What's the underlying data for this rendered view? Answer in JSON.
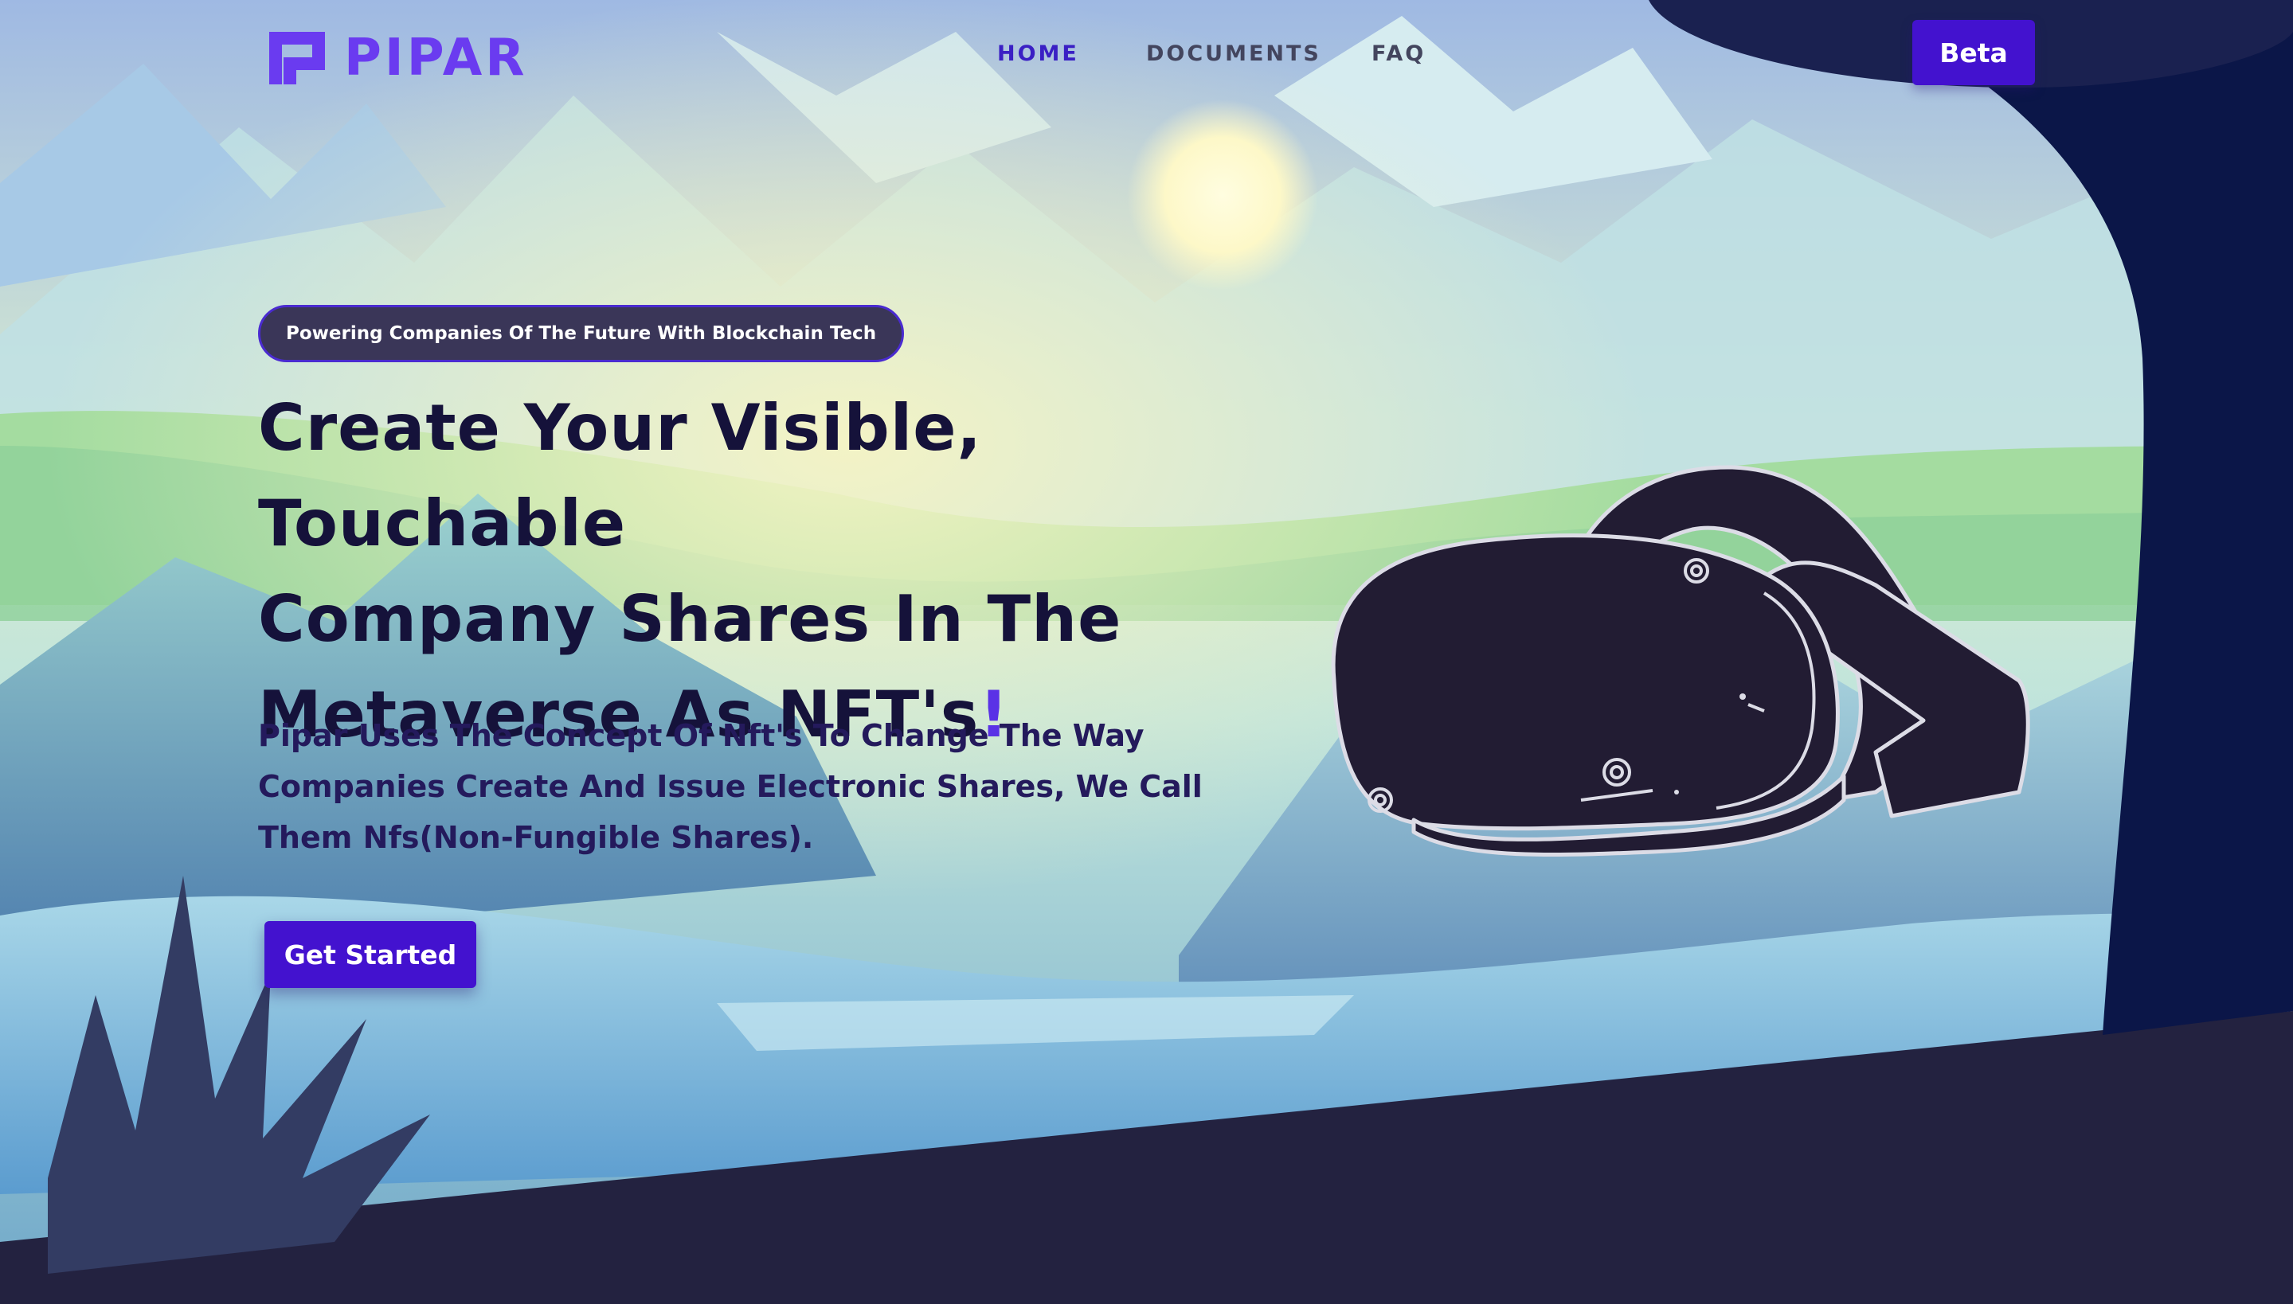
{
  "brand": {
    "name": "PIPAR",
    "logo_icon": "pipar-logo-icon"
  },
  "nav": {
    "items": [
      {
        "label": "HOME",
        "active": true
      },
      {
        "label": "DOCUMENTS",
        "active": false
      },
      {
        "label": "FAQ",
        "active": false
      }
    ],
    "beta_label": "Beta"
  },
  "hero": {
    "badge": "Powering Companies Of The Future With Blockchain Tech",
    "title_line1": "Create Your Visible, Touchable",
    "title_line2": "Company Shares In The",
    "title_line3": "Metaverse As NFT's",
    "title_accent": "!",
    "description": "Pipar Uses The Concept Of Nft's To Change The Way Companies Create And Issue Electronic Shares, We Call Them Nfs(Non-Fungible Shares).",
    "cta_label": "Get Started",
    "illustration_icon": "vr-headset-icon"
  },
  "colors": {
    "accent": "#4312cf",
    "brand_purple": "#6a3bf0",
    "title": "#15123a",
    "footer_band": "#232240"
  }
}
